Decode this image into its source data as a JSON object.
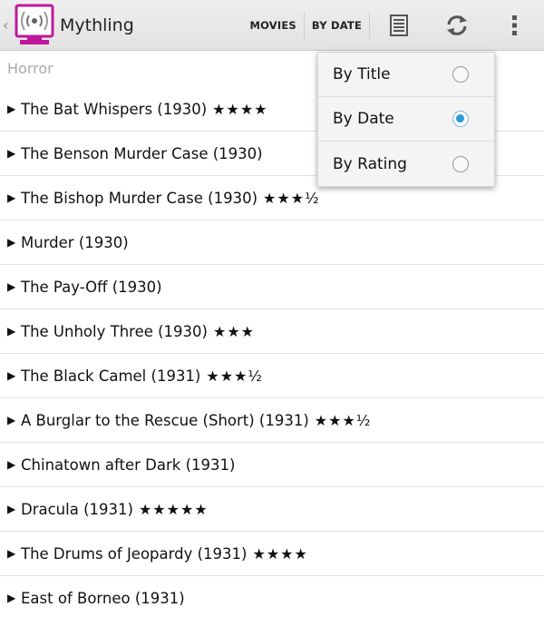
{
  "actionbar": {
    "up_caret": "‹",
    "app_title": "Mythling",
    "buttons": {
      "movies": "MOVIES",
      "by_date": "BY DATE"
    },
    "icons": [
      "list-view-icon",
      "refresh-icon",
      "overflow-menu-icon"
    ],
    "colors": {
      "app_icon_accent": "#c0189c"
    }
  },
  "section": {
    "header": "Horror"
  },
  "items": [
    {
      "title": "The Bat Whispers (1930)",
      "rating": "★★★★"
    },
    {
      "title": "The Benson Murder Case (1930)",
      "rating": ""
    },
    {
      "title": "The Bishop Murder Case (1930)",
      "rating": "★★★½"
    },
    {
      "title": "Murder (1930)",
      "rating": ""
    },
    {
      "title": "The Pay-Off (1930)",
      "rating": ""
    },
    {
      "title": "The Unholy Three (1930)",
      "rating": "★★★"
    },
    {
      "title": "The Black Camel (1931)",
      "rating": "★★★½"
    },
    {
      "title": "A Burglar to the Rescue (Short) (1931)",
      "rating": "★★★½"
    },
    {
      "title": "Chinatown after Dark (1931)",
      "rating": ""
    },
    {
      "title": "Dracula (1931)",
      "rating": "★★★★★"
    },
    {
      "title": "The Drums of Jeopardy (1931)",
      "rating": "★★★★"
    },
    {
      "title": "East of Borneo (1931)",
      "rating": ""
    }
  ],
  "sort_menu": {
    "options": [
      {
        "label": "By Title",
        "selected": false
      },
      {
        "label": "By Date",
        "selected": true
      },
      {
        "label": "By Rating",
        "selected": false
      }
    ],
    "colors": {
      "radio_selected": "#2a9bd8"
    }
  }
}
